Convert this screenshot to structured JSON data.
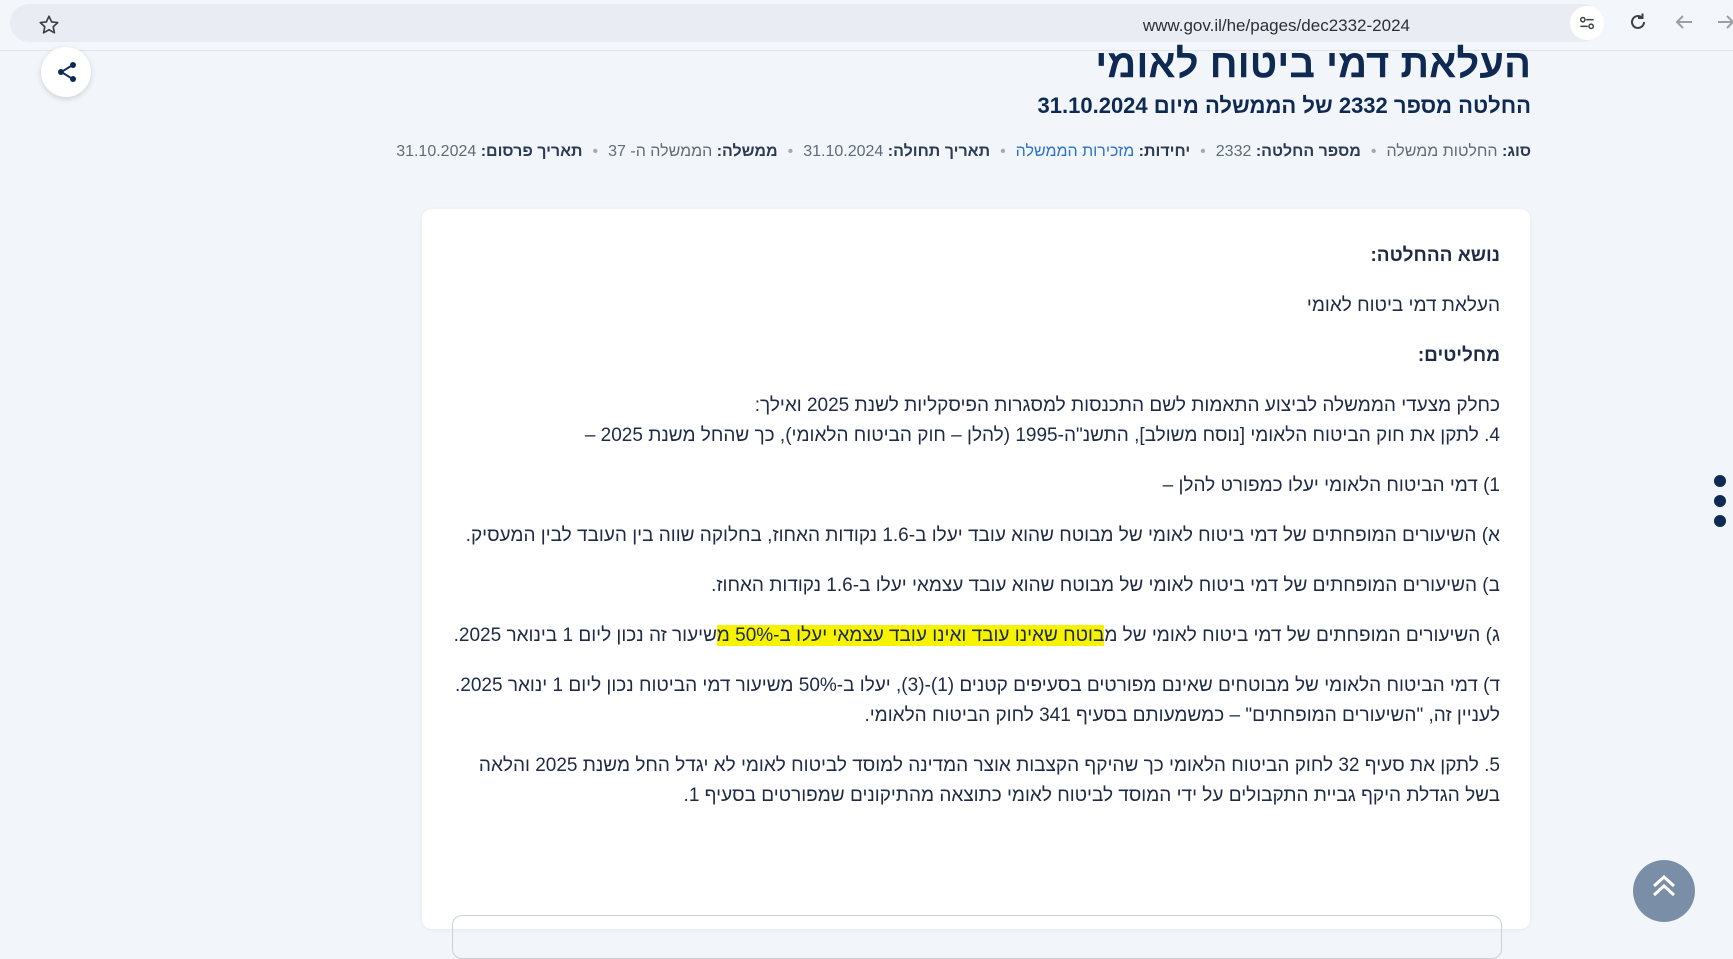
{
  "browser": {
    "url": "www.gov.il/he/pages/dec2332-2024"
  },
  "header": {
    "title": "העלאת דמי ביטוח לאומי",
    "subtitle": "החלטה מספר 2332 של הממשלה מיום 31.10.2024"
  },
  "meta": [
    {
      "label": "סוג:",
      "value": "החלטות ממשלה",
      "link": false
    },
    {
      "label": "מספר החלטה:",
      "value": "2332",
      "link": false
    },
    {
      "label": "יחידות:",
      "value": "מזכירות הממשלה",
      "link": true
    },
    {
      "label": "תאריך תחולה:",
      "value": "31.10.2024",
      "link": false
    },
    {
      "label": "ממשלה:",
      "value": "הממשלה ה- 37",
      "link": false
    },
    {
      "label": "תאריך פרסום:",
      "value": "31.10.2024",
      "link": false
    }
  ],
  "content": {
    "subject_heading": "נושא ההחלטה:",
    "subject_text": "העלאת דמי ביטוח לאומי",
    "decides_heading": "מחליטים:",
    "intro_line": "כחלק מצעדי הממשלה לביצוע התאמות לשם התכנסות למסגרות הפיסקליות לשנת 2025 ואילך:",
    "item4": "4. לתקן את חוק הביטוח הלאומי [נוסח משולב], התשנ\"ה-1995 (להלן – חוק הביטוח הלאומי), כך שהחל משנת 2025 –",
    "sub1": "1) דמי הביטוח הלאומי יעלו כמפורט להלן –",
    "sub_a": "א) השיעורים המופחתים של דמי ביטוח לאומי של מבוטח שהוא עובד יעלו ב-1.6 נקודות האחוז, בחלוקה שווה בין העובד לבין המעסיק.",
    "sub_b": "ב) השיעורים המופחתים של דמי ביטוח לאומי של מבוטח שהוא עובד עצמאי יעלו ב-1.6 נקודות האחוז.",
    "sub_g_before": "ג) השיעורים המופחתים של דמי ביטוח לאומי של מ",
    "sub_g_highlight": "בוטח שאינו עובד ואינו עובד עצמאי יעלו ב-50% מ",
    "sub_g_after": "שיעור זה נכון ליום 1 בינואר 2025.",
    "sub_d": "ד) דמי הביטוח הלאומי של מבוטחים שאינם מפורטים בסעיפים קטנים (1)-(3), יעלו ב-50% משיעור דמי הביטוח נכון ליום 1 ינואר 2025.",
    "note": "לעניין זה, \"השיעורים המופחתים\" – כמשמעותם בסעיף 341 לחוק הביטוח הלאומי.",
    "item5": "5. לתקן את סעיף 32 לחוק הביטוח הלאומי כך שהיקף הקצבות אוצר המדינה למוסד לביטוח לאומי לא יגדל החל משנת 2025 והלאה בשל הגדלת היקף גביית התקבולים על ידי המוסד לביטוח לאומי כתוצאה מהתיקונים שמפורטים בסעיף 1."
  },
  "colors": {
    "page_bg": "#f2f6fb",
    "title": "#0f2a52",
    "link": "#2a72c9",
    "highlight": "#f7f200"
  }
}
